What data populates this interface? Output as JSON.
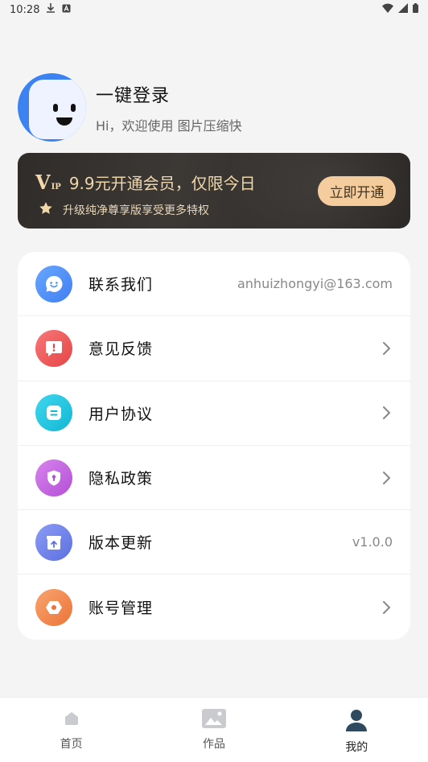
{
  "status_bar": {
    "time": "10:28",
    "icons": [
      "download-icon",
      "a-icon",
      "wifi-icon",
      "signal-icon",
      "battery-icon"
    ]
  },
  "profile": {
    "title": "一键登录",
    "subtitle": "Hi，欢迎使用 图片压缩快"
  },
  "vip": {
    "badge_v": "V",
    "badge_ip": "IP",
    "title": "9.9元开通会员，仅限今日",
    "desc": "升级纯净尊享版享受更多特权",
    "button": "立即开通"
  },
  "menu": {
    "items": [
      {
        "label": "联系我们",
        "value": "anhuizhongyi@163.com",
        "icon": "chat-smile-icon",
        "color": "#4a8df5"
      },
      {
        "label": "意见反馈",
        "icon": "feedback-icon",
        "color": "#ec5b5b"
      },
      {
        "label": "用户协议",
        "icon": "document-icon",
        "color": "#22c3df"
      },
      {
        "label": "隐私政策",
        "icon": "shield-icon",
        "color": "#c061dc"
      },
      {
        "label": "版本更新",
        "value": "v1.0.0",
        "icon": "update-box-icon",
        "color": "#6a7ee8"
      },
      {
        "label": "账号管理",
        "icon": "hexagon-icon",
        "color": "#f08a4c"
      }
    ]
  },
  "tabs": [
    {
      "label": "首页",
      "icon": "home-icon"
    },
    {
      "label": "作品",
      "icon": "image-icon"
    },
    {
      "label": "我的",
      "icon": "user-icon",
      "active": true
    }
  ]
}
